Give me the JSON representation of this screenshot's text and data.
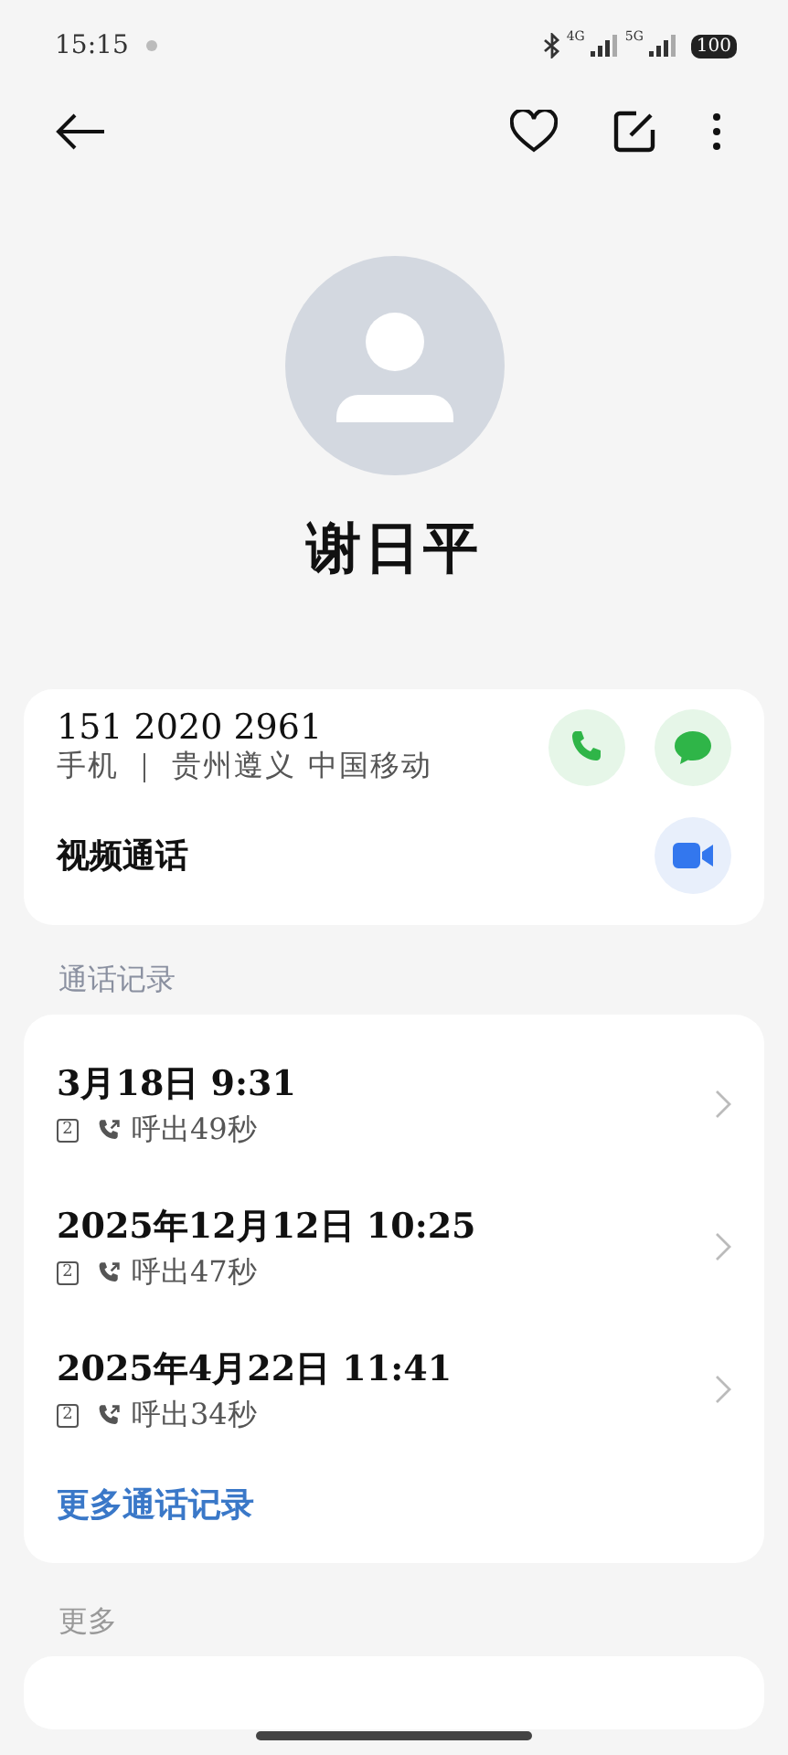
{
  "status_bar": {
    "time": "15:15",
    "network_1": "4G",
    "network_2": "5G",
    "battery": "100"
  },
  "contact": {
    "name": "谢日平"
  },
  "phone": {
    "number": "151 2020 2961",
    "detail": "手机 ｜ 贵州遵义 中国移动",
    "video_label": "视频通话"
  },
  "call_log": {
    "title": "通话记录",
    "entries": [
      {
        "time": "3月18日 9:31",
        "sim": "2",
        "summary": "呼出49秒"
      },
      {
        "time": "2025年12月12日 10:25",
        "sim": "2",
        "summary": "呼出47秒"
      },
      {
        "time": "2025年4月22日 11:41",
        "sim": "2",
        "summary": "呼出34秒"
      }
    ],
    "more_link": "更多通话记录"
  },
  "more": {
    "title": "更多"
  }
}
